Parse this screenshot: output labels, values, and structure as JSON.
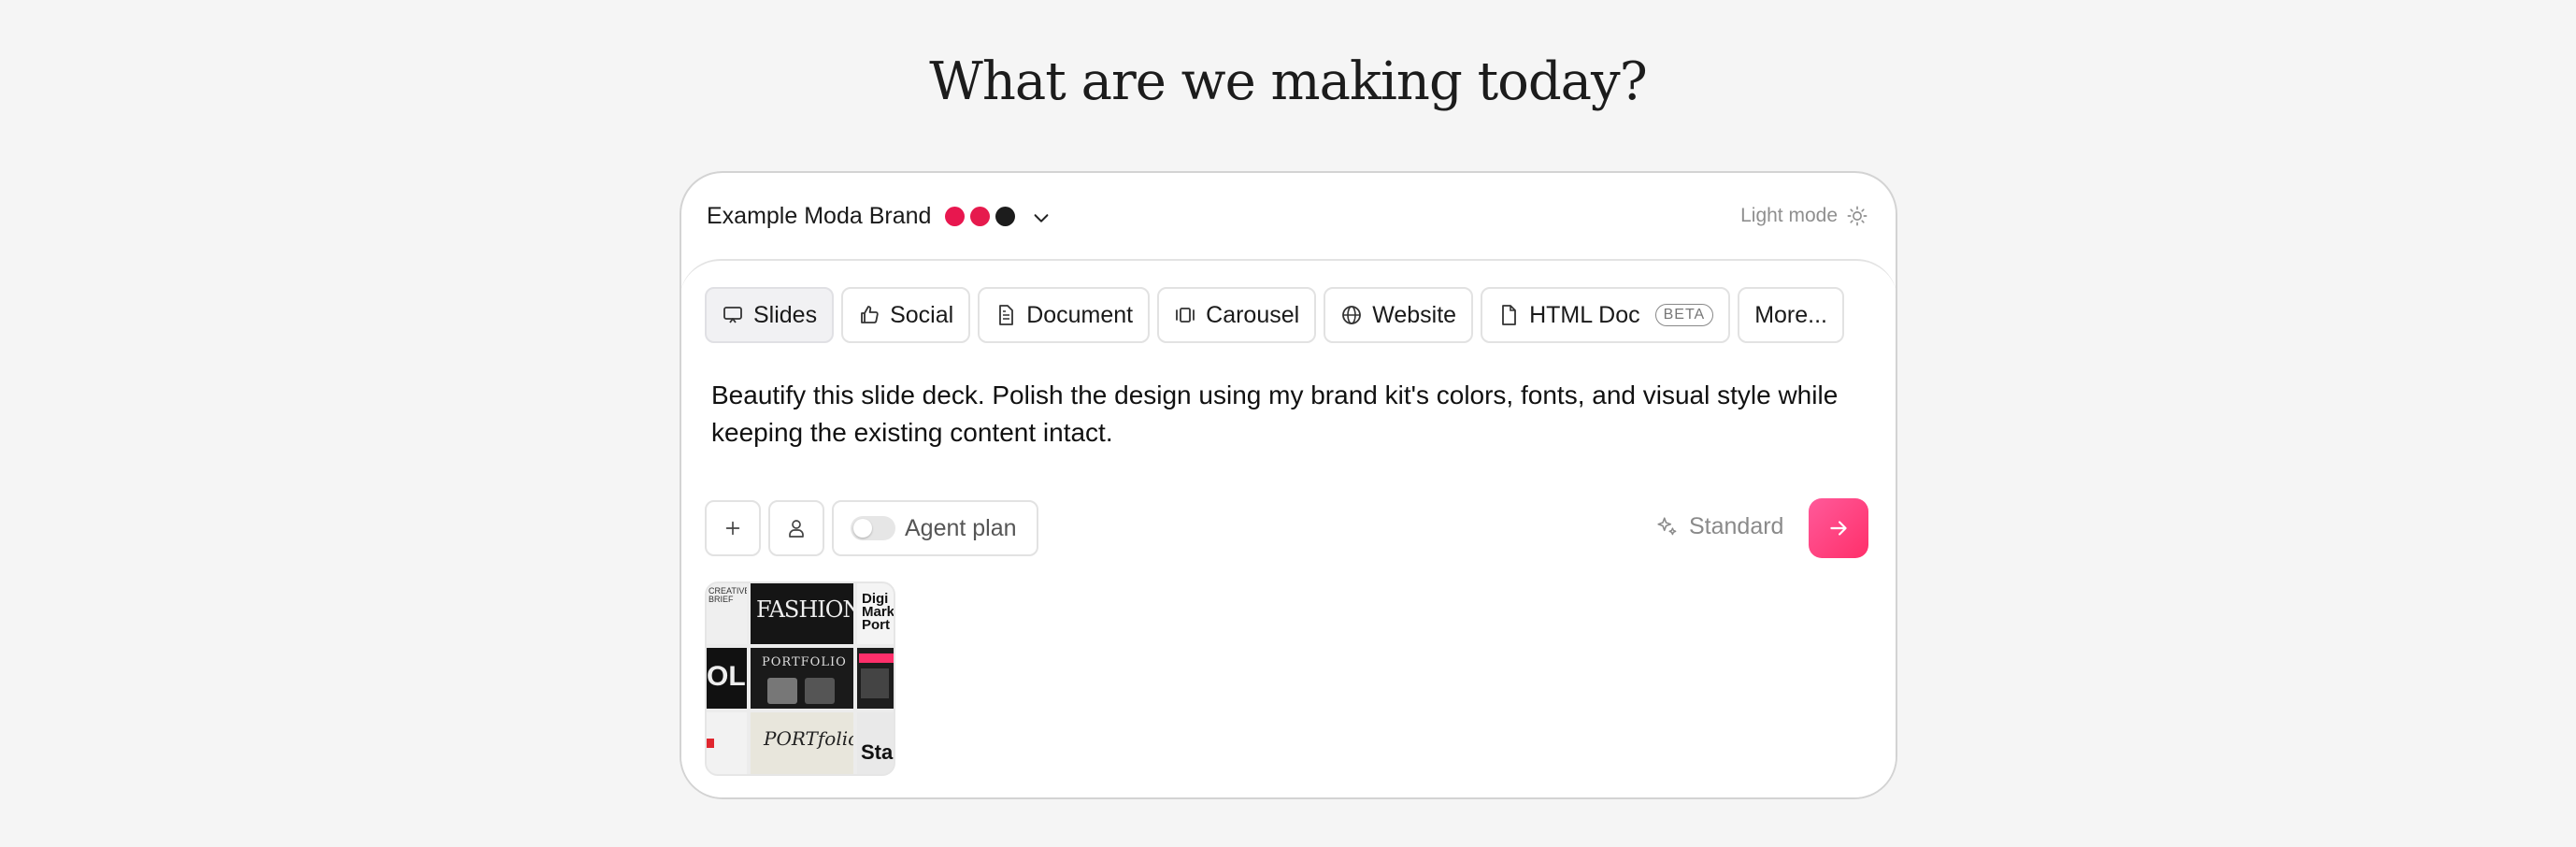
{
  "headline": "What are we making today?",
  "brand": {
    "name": "Example Moda Brand",
    "swatches": [
      "#e8174f",
      "#e61a4d",
      "#1c1c1c"
    ]
  },
  "light_mode_label": "Light mode",
  "tabs": [
    {
      "label": "Slides",
      "icon": "presentation-icon"
    },
    {
      "label": "Social",
      "icon": "thumbs-up-icon"
    },
    {
      "label": "Document",
      "icon": "document-icon"
    },
    {
      "label": "Carousel",
      "icon": "carousel-icon"
    },
    {
      "label": "Website",
      "icon": "globe-icon"
    },
    {
      "label": "HTML Doc",
      "icon": "file-icon",
      "badge": "BETA"
    },
    {
      "label": "More..."
    }
  ],
  "prompt_text": "Beautify this slide deck. Polish the design using my brand kit's colors, fonts, and visual style while keeping the existing content intact.",
  "toolbar": {
    "agent_plan_label": "Agent plan",
    "model_label": "Standard"
  },
  "thumbnail_text": {
    "fashion": "FASHION",
    "portfolio": "PORTFOLIO",
    "portfolio_script": "PORTfolio",
    "creative": "CREATIVE BRIEF",
    "olio": "OLIO",
    "digital": "Digi Mark Port",
    "sta": "Sta"
  }
}
